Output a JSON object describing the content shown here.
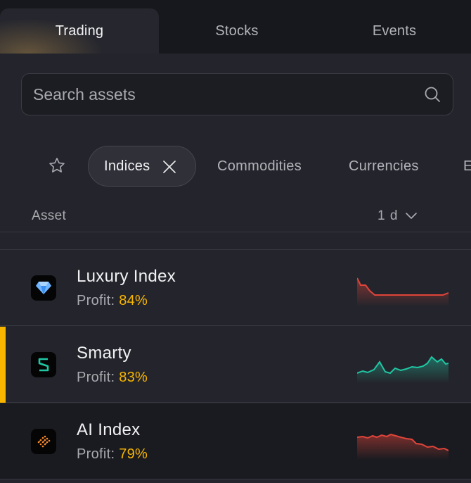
{
  "tabs": [
    {
      "label": "Trading",
      "active": true
    },
    {
      "label": "Stocks",
      "active": false
    },
    {
      "label": "Events",
      "active": false
    }
  ],
  "search": {
    "placeholder": "Search assets",
    "value": ""
  },
  "filters": {
    "favorites_icon": "star-icon",
    "active_chip": {
      "label": "Indices",
      "close_icon": "close-icon"
    },
    "chips": [
      "Commodities",
      "Currencies",
      "E"
    ]
  },
  "table_header": {
    "asset_label": "Asset",
    "period": "1 d",
    "period_icon": "chevron-down-icon"
  },
  "assets": [
    {
      "name": "Luxury Index",
      "profit_label": "Profit:",
      "profit_value": "84%",
      "icon": "diamond-icon",
      "trend_color": "#e0443a",
      "selected": false
    },
    {
      "name": "Smarty",
      "profit_label": "Profit:",
      "profit_value": "83%",
      "icon": "smarty-s-icon",
      "trend_color": "#1fc7a4",
      "selected": true
    },
    {
      "name": "AI Index",
      "profit_label": "Profit:",
      "profit_value": "79%",
      "icon": "ai-chip-icon",
      "trend_color": "#e0443a",
      "selected": false
    }
  ],
  "colors": {
    "accent": "#f7b500",
    "negative": "#e0443a",
    "positive": "#1fc7a4"
  }
}
